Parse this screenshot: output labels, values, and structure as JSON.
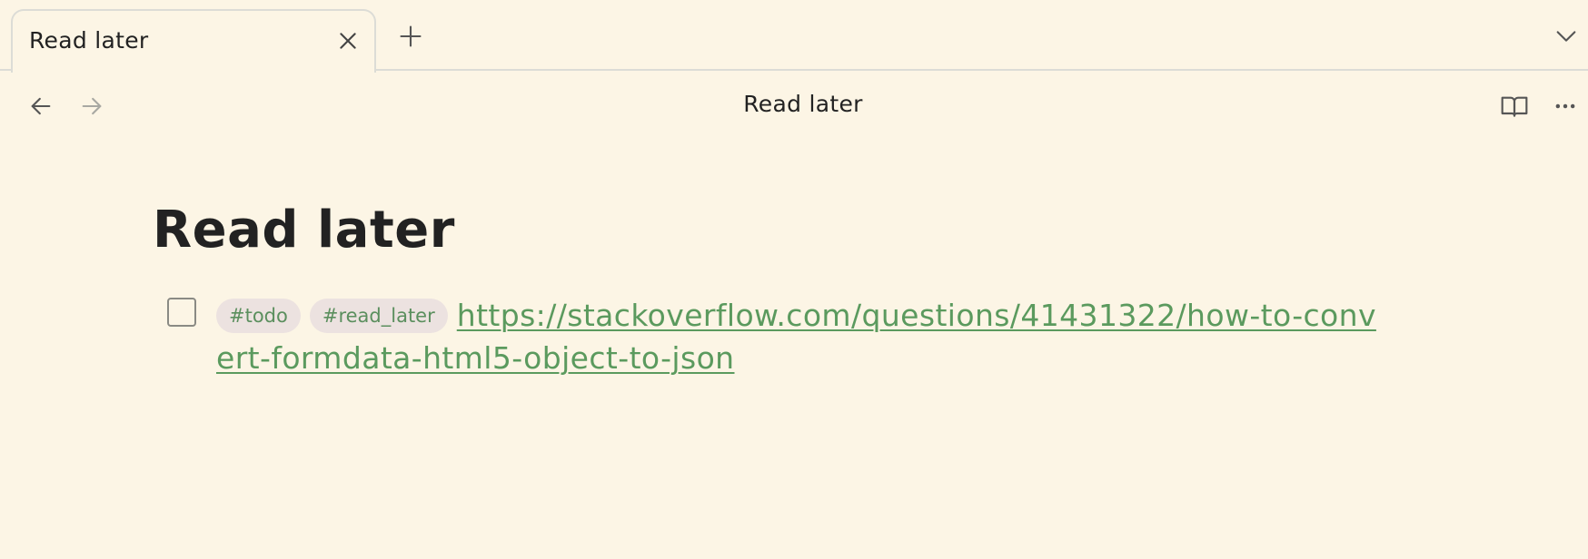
{
  "tabs": [
    {
      "label": "Read later",
      "active": true
    }
  ],
  "tabbar": {
    "close_icon": "close-icon",
    "new_tab_icon": "plus-icon",
    "tab_list_icon": "chevron-down-icon"
  },
  "header": {
    "title": "Read later",
    "back_icon": "arrow-left-icon",
    "forward_icon": "arrow-right-icon",
    "reading_mode_icon": "book-open-icon",
    "more_icon": "more-horizontal-icon"
  },
  "note": {
    "title": "Read later",
    "tasks": [
      {
        "checked": false,
        "tags": [
          "#todo",
          "#read_later"
        ],
        "link_line1": "https://stackoverflow.com/questions/41431322/how-to-conv",
        "link_line2": "ert-formdata-html5-object-to-json"
      }
    ]
  },
  "colors": {
    "background": "#fcf5e5",
    "text": "#222222",
    "link": "#5b9a5e",
    "tag_background": "#ece2e0",
    "border": "#dcdcd6"
  }
}
